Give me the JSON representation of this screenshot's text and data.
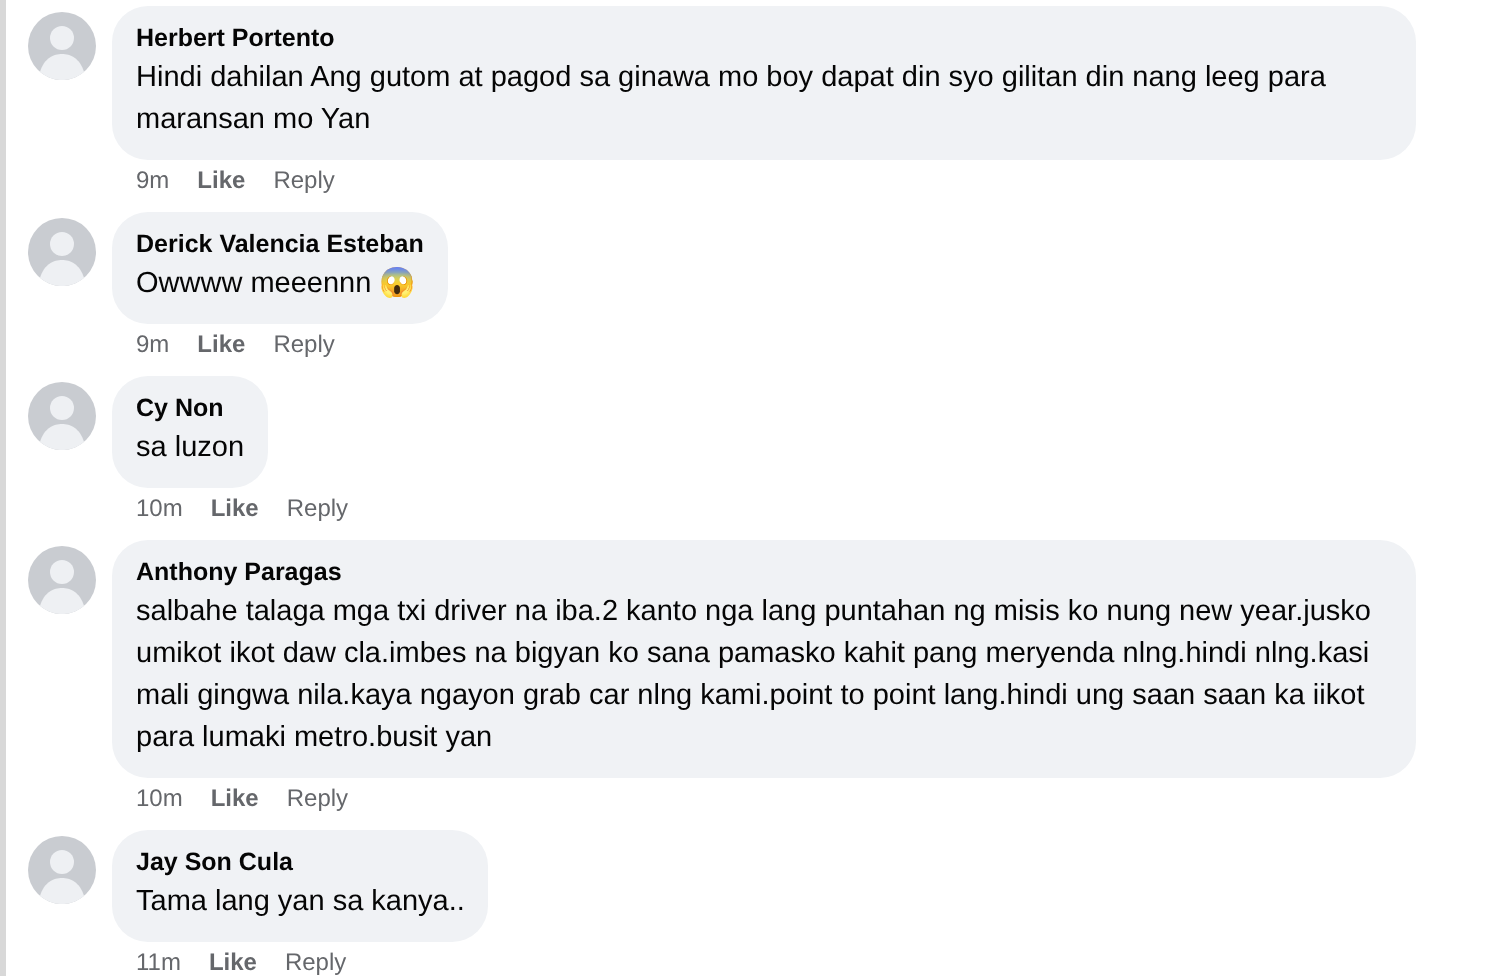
{
  "comments": [
    {
      "author": "Herbert Portento",
      "text": "Hindi dahilan Ang gutom at pagod sa ginawa mo boy dapat din syo gilitan din nang leeg para maransan mo Yan",
      "time": "9m",
      "like": "Like",
      "reply": "Reply"
    },
    {
      "author": "Derick Valencia Esteban",
      "text": "Owwww meeennn 😱",
      "time": "9m",
      "like": "Like",
      "reply": "Reply"
    },
    {
      "author": "Cy Non",
      "text": "sa luzon",
      "time": "10m",
      "like": "Like",
      "reply": "Reply"
    },
    {
      "author": "Anthony Paragas",
      "text": "salbahe talaga mga txi driver na iba.2 kanto nga lang puntahan ng misis ko nung new year.jusko umikot ikot daw cla.imbes na bigyan ko sana pamasko kahit pang meryenda nlng.hindi nlng.kasi mali gingwa nila.kaya ngayon grab car nlng kami.point to point lang.hindi ung saan saan ka iikot para lumaki metro.busit yan",
      "time": "10m",
      "like": "Like",
      "reply": "Reply"
    },
    {
      "author": "Jay Son Cula",
      "text": "Tama lang yan sa kanya..",
      "time": "11m",
      "like": "Like",
      "reply": "Reply"
    }
  ]
}
